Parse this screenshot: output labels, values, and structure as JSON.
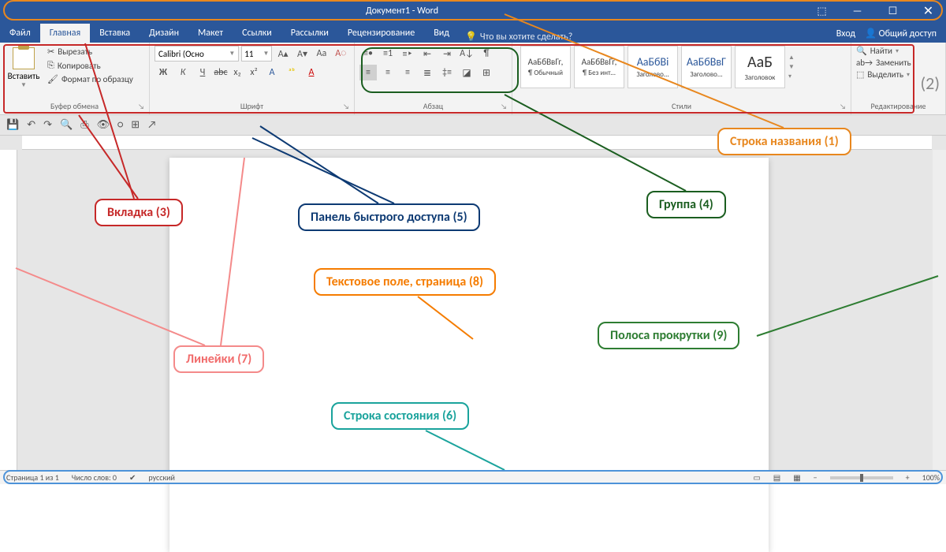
{
  "titlebar": {
    "title": "Документ1 - Word"
  },
  "tabs": {
    "file": "Файл",
    "home": "Главная",
    "insert": "Вставка",
    "design": "Дизайн",
    "layout": "Макет",
    "references": "Ссылки",
    "mailings": "Рассылки",
    "review": "Рецензирование",
    "view": "Вид",
    "tellme": "Что вы хотите сделать?",
    "signin": "Вход",
    "share": "Общий доступ"
  },
  "clipboard": {
    "paste": "Вставить",
    "cut": "Вырезать",
    "copy": "Копировать",
    "format_painter": "Формат по образцу",
    "label": "Буфер обмена"
  },
  "font": {
    "name": "Calibri (Осно",
    "size": "11",
    "label": "Шрифт"
  },
  "paragraph": {
    "label": "Абзац"
  },
  "styles": {
    "label": "Стили",
    "items": [
      {
        "preview": "АаБбВвГг,",
        "name": "¶ Обычный"
      },
      {
        "preview": "АаБбВвГг,",
        "name": "¶ Без инт..."
      },
      {
        "preview": "АаБбВі",
        "name": "Заголово..."
      },
      {
        "preview": "АаБбВвГ",
        "name": "Заголово..."
      },
      {
        "preview": "АаБ",
        "name": "Заголовок"
      }
    ]
  },
  "editing": {
    "find": "Найти",
    "replace": "Заменить",
    "select": "Выделить",
    "label": "Редактирование"
  },
  "status": {
    "page": "Страница 1 из 1",
    "words": "Число слов: 0",
    "lang": "русский",
    "zoom": "100%"
  },
  "callouts": {
    "c1": "Строка названия (1)",
    "c2": "(2)",
    "c3": "Вкладка (3)",
    "c4": "Группа (4)",
    "c5": "Панель быстрого доступа (5)",
    "c6": "Строка состояния (6)",
    "c7": "Линейки (7)",
    "c8": "Текстовое поле, страница (8)",
    "c9": "Полоса прокрутки (9)"
  }
}
